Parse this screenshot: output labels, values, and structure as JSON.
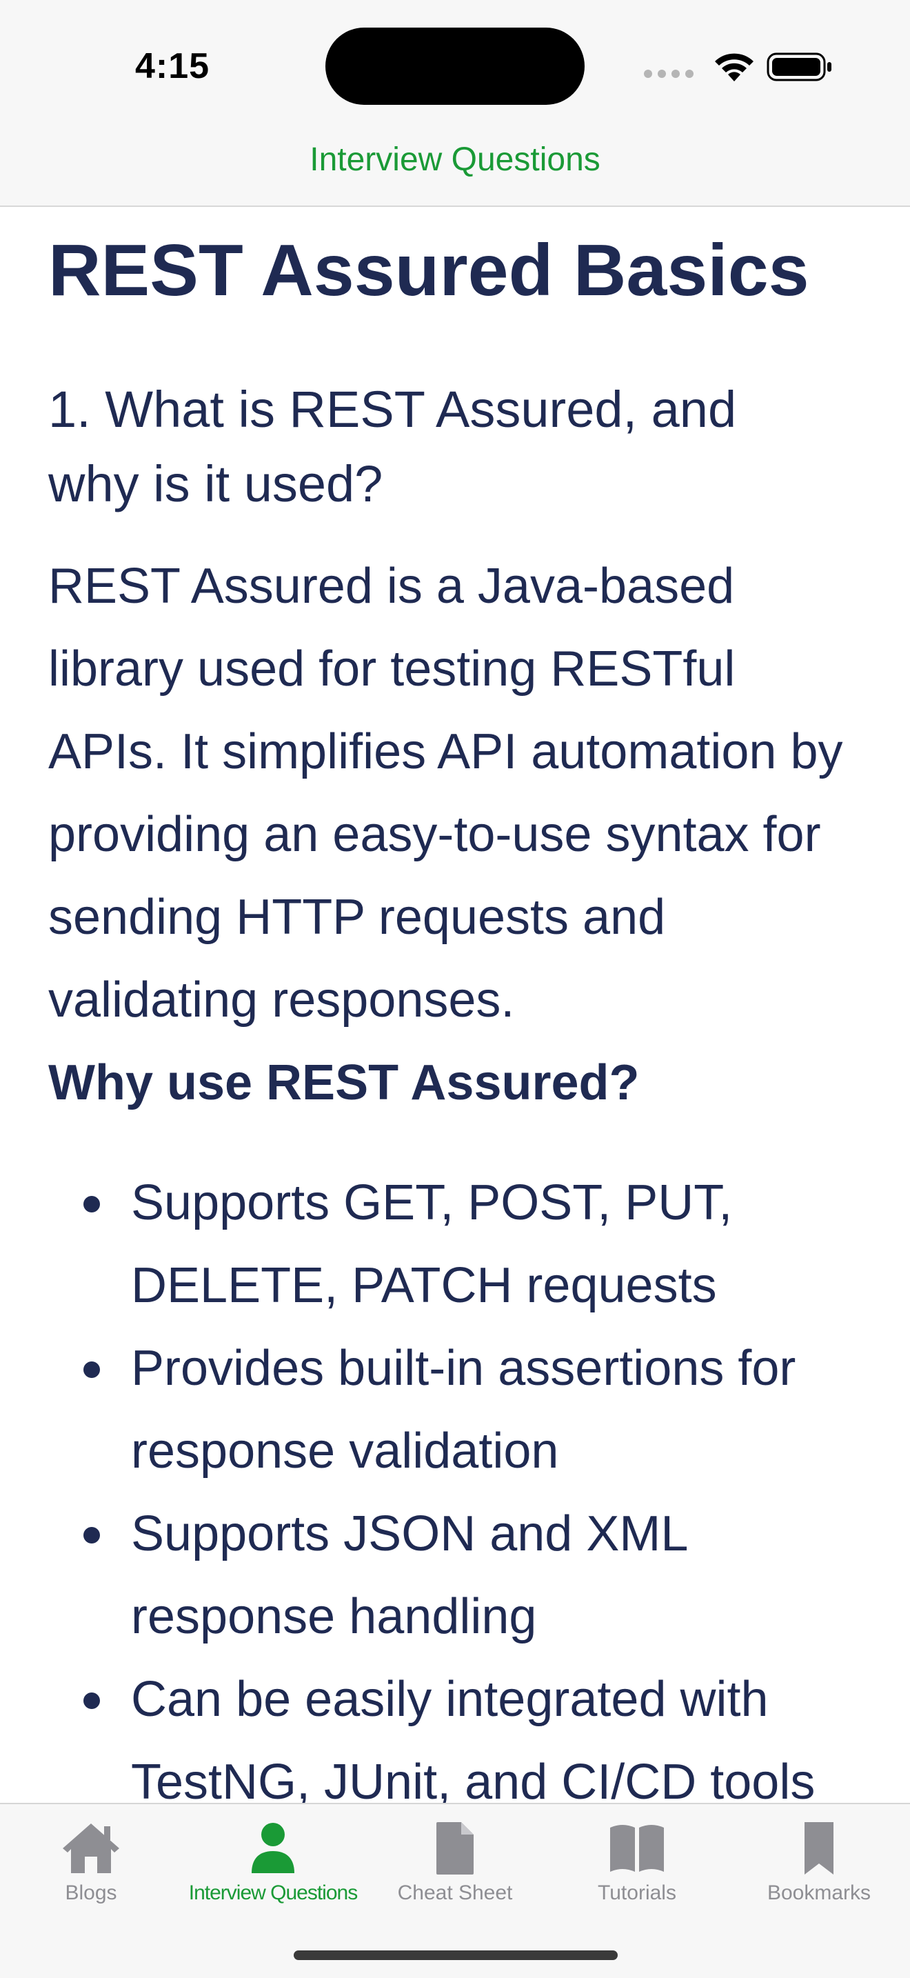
{
  "status_bar": {
    "time": "4:15"
  },
  "nav": {
    "title": "Interview Questions"
  },
  "content": {
    "title": "REST Assured Basics",
    "question": "1. What is REST Assured, and why is it used?",
    "answer": "REST Assured is a Java-based library used for testing RESTful APIs. It simplifies API automation by providing an easy-to-use syntax for sending HTTP requests and validating responses.",
    "subheading": "Why use REST Assured?",
    "bullets": [
      "Supports GET, POST, PUT, DELETE, PATCH requests",
      "Provides built-in assertions for response validation",
      "Supports JSON and XML response handling",
      "Can be easily integrated with TestNG, JUnit, and CI/CD tools"
    ]
  },
  "tabbar": {
    "items": [
      {
        "label": "Blogs",
        "icon": "house-icon",
        "active": false
      },
      {
        "label": "Interview Questions",
        "icon": "person-icon",
        "active": true
      },
      {
        "label": "Cheat Sheet",
        "icon": "document-icon",
        "active": false
      },
      {
        "label": "Tutorials",
        "icon": "book-icon",
        "active": false
      },
      {
        "label": "Bookmarks",
        "icon": "bookmark-icon",
        "active": false
      }
    ],
    "active_color": "#1a9a36",
    "inactive_color": "#8e8e93"
  }
}
